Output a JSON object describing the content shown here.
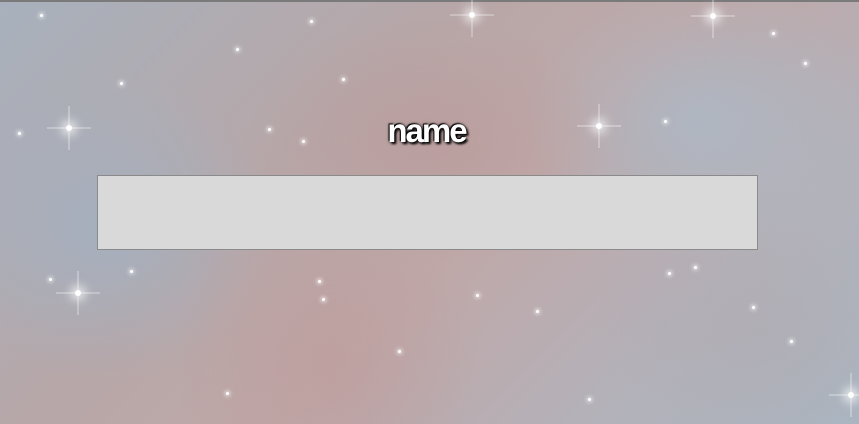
{
  "form": {
    "label": "name",
    "input_value": "",
    "input_placeholder": ""
  },
  "colors": {
    "input_background": "#d9d9d9",
    "input_border": "#8a8a8a",
    "label_text": "#ffffff",
    "label_shadow": "#000000"
  },
  "background": {
    "icon": "nebula-starfield"
  }
}
